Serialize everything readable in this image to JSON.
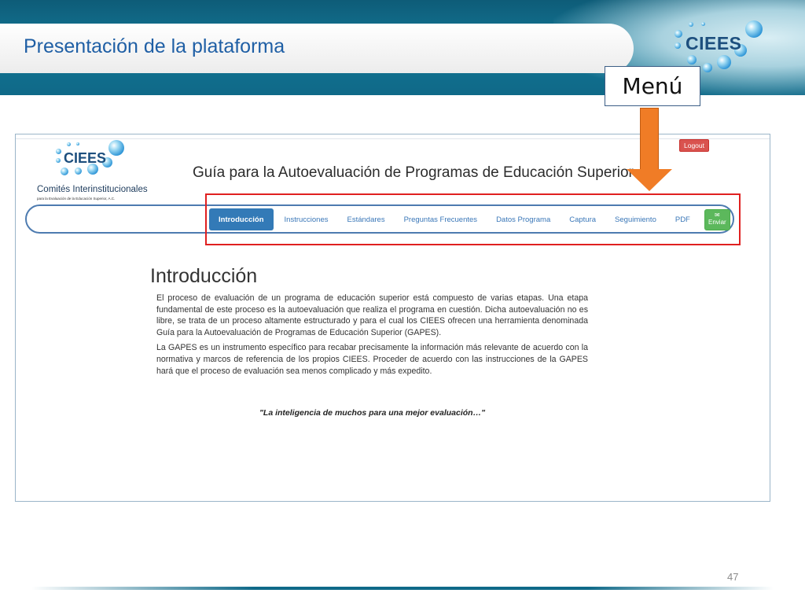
{
  "slide": {
    "title": "Presentación de la plataforma",
    "callout_label": "Menú",
    "page_number": "47",
    "logo_text": "CIEES"
  },
  "site": {
    "logo_text": "CIEES",
    "org_name": "Comités Interinstitucionales",
    "org_subtitle": "para la Evaluación de la Educación Superior, A.C.",
    "title": "Guía para la Autoevaluación de Programas de Educación Superior",
    "logout_label": "Logout",
    "nav": {
      "items": [
        {
          "label": "Introducción",
          "active": true
        },
        {
          "label": "Instrucciones"
        },
        {
          "label": "Estándares"
        },
        {
          "label": "Preguntas Frecuentes"
        },
        {
          "label": "Datos Programa"
        },
        {
          "label": "Captura"
        },
        {
          "label": "Seguimiento"
        },
        {
          "label": "PDF"
        }
      ],
      "send_label": "Enviar",
      "send_icon": "envelope-icon"
    },
    "content": {
      "heading": "Introducción",
      "paragraphs": [
        "El proceso de evaluación de un programa de educación superior está compuesto de varias etapas. Una etapa fundamental de este proceso es la autoevaluación que realiza el programa en cuestión. Dicha autoevaluación no es libre, se trata de un proceso altamente estructurado y para el cual los CIEES ofrecen una herramienta denominada Guía para la Autoevaluación de Programas de Educación Superior (GAPES).",
        "La GAPES es un instrumento específico para recabar precisamente la información más relevante de acuerdo con la normativa y marcos de referencia de los propios CIEES. Proceder de acuerdo con las instrucciones de la GAPES hará que el proceso de evaluación sea menos complicado y más expedito."
      ],
      "quote": "\"La inteligencia de muchos para una mejor evaluación…\""
    }
  },
  "colors": {
    "header_teal": "#137594",
    "title_blue": "#1f5fa5",
    "arrow_orange": "#f07c26",
    "highlight_red": "#e02020",
    "nav_active": "#337ab7",
    "logout_red": "#d9534f",
    "send_green": "#5cb85c"
  }
}
